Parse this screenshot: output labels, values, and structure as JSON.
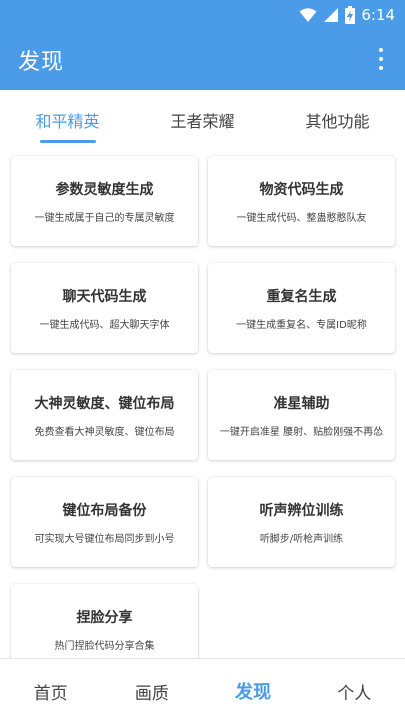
{
  "status": {
    "time": "6:14"
  },
  "header": {
    "title": "发现"
  },
  "tabs": [
    {
      "label": "和平精英",
      "active": true
    },
    {
      "label": "王者荣耀",
      "active": false
    },
    {
      "label": "其他功能",
      "active": false
    }
  ],
  "cards": [
    {
      "title": "参数灵敏度生成",
      "desc": "一键生成属于自己的专属灵敏度"
    },
    {
      "title": "物资代码生成",
      "desc": "一键生成代码、整蛊憨憨队友"
    },
    {
      "title": "聊天代码生成",
      "desc": "一键生成代码、超大聊天字体"
    },
    {
      "title": "重复名生成",
      "desc": "一键生成重复名、专属ID昵称"
    },
    {
      "title": "大神灵敏度、键位布局",
      "desc": "免费查看大神灵敏度、键位布局"
    },
    {
      "title": "准星辅助",
      "desc": "一键开启准星 腰射、贴脸刚强不再怂"
    },
    {
      "title": "键位布局备份",
      "desc": "可实现大号键位布局同步到小号"
    },
    {
      "title": "听声辨位训练",
      "desc": "听脚步/听枪声训练"
    },
    {
      "title": "捏脸分享",
      "desc": "热门捏脸代码分享合集"
    }
  ],
  "bottom_nav": [
    {
      "label": "首页",
      "active": false
    },
    {
      "label": "画质",
      "active": false
    },
    {
      "label": "发现",
      "active": true
    },
    {
      "label": "个人",
      "active": false
    }
  ],
  "colors": {
    "accent": "#4a9be8"
  }
}
